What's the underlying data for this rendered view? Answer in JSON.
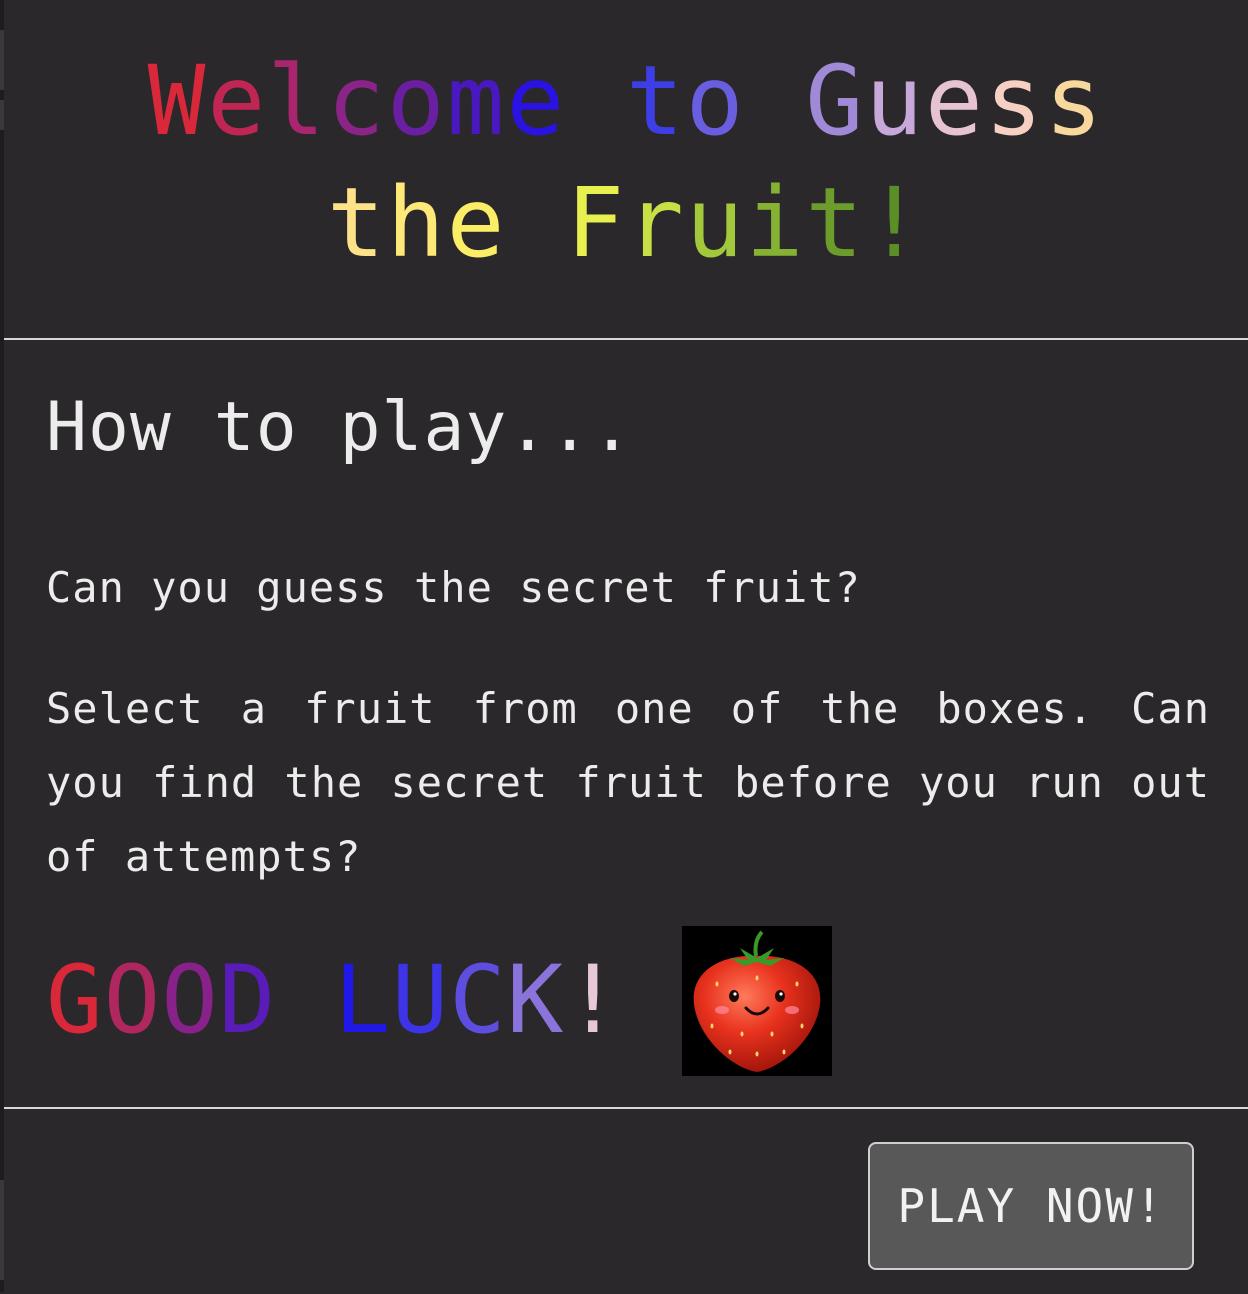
{
  "modal": {
    "title_line1": [
      {
        "ch": "W",
        "color": "#d8283a"
      },
      {
        "ch": "e",
        "color": "#c02654"
      },
      {
        "ch": "l",
        "color": "#a9266e"
      },
      {
        "ch": "c",
        "color": "#8a2488"
      },
      {
        "ch": "o",
        "color": "#6a1ea2"
      },
      {
        "ch": "m",
        "color": "#4a18c0"
      },
      {
        "ch": "e",
        "color": "#2a12e0"
      },
      {
        "ch": " ",
        "color": "#2a282a"
      },
      {
        "ch": "t",
        "color": "#3d3ee6"
      },
      {
        "ch": "o",
        "color": "#6a5ee0"
      },
      {
        "ch": " ",
        "color": "#2a282a"
      },
      {
        "ch": "G",
        "color": "#a08ad8"
      },
      {
        "ch": "u",
        "color": "#c8a8da"
      },
      {
        "ch": "e",
        "color": "#e6c2d2"
      },
      {
        "ch": "s",
        "color": "#f6d0c2"
      },
      {
        "ch": "s",
        "color": "#f8d89c"
      }
    ],
    "title_line2": [
      {
        "ch": "t",
        "color": "#fde28a"
      },
      {
        "ch": "h",
        "color": "#fde878"
      },
      {
        "ch": "e",
        "color": "#fbee66"
      },
      {
        "ch": " ",
        "color": "#2a282a"
      },
      {
        "ch": "F",
        "color": "#e8f050"
      },
      {
        "ch": "r",
        "color": "#c8e046"
      },
      {
        "ch": "u",
        "color": "#a2c83c"
      },
      {
        "ch": "i",
        "color": "#86b234"
      },
      {
        "ch": "t",
        "color": "#6c9c2c"
      },
      {
        "ch": "!",
        "color": "#5a8e26"
      }
    ],
    "how_to_play_heading": "How to play...",
    "paragraph1": "Can you guess the secret fruit?",
    "paragraph2": "Select a fruit from one of the boxes. Can you find the secret fruit before you run out of attempts?",
    "good_luck": [
      {
        "ch": "G",
        "color": "#d8283a"
      },
      {
        "ch": "O",
        "color": "#b0265e"
      },
      {
        "ch": "O",
        "color": "#88228a"
      },
      {
        "ch": "D",
        "color": "#5a1cb8"
      },
      {
        "ch": " ",
        "color": "#2a282a"
      },
      {
        "ch": "L",
        "color": "#2018e8"
      },
      {
        "ch": "U",
        "color": "#3c34e6"
      },
      {
        "ch": "C",
        "color": "#5e4ee0"
      },
      {
        "ch": "K",
        "color": "#8a74dc"
      },
      {
        "ch": "!",
        "color": "#e6c8d8"
      }
    ],
    "play_button_label": "PLAY NOW!"
  }
}
